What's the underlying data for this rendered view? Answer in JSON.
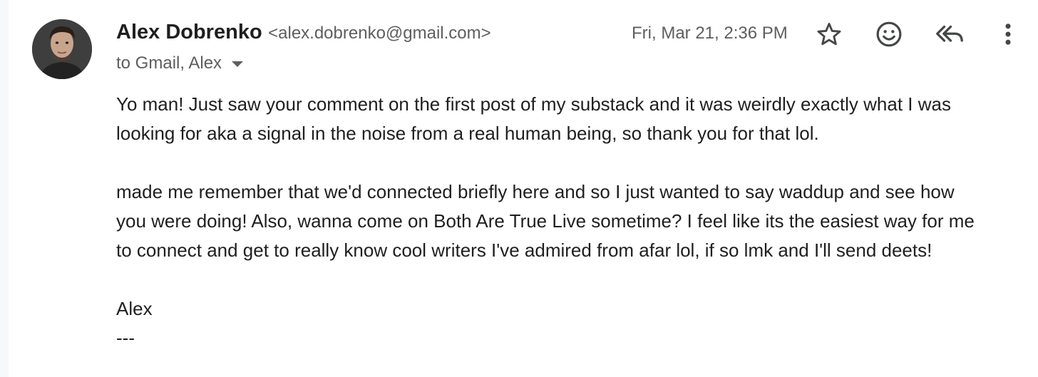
{
  "email": {
    "sender_name": "Alex Dobrenko",
    "sender_email": "<alex.dobrenko@gmail.com>",
    "recipients": "to Gmail, Alex",
    "date": "Fri, Mar 21, 2:36 PM",
    "body": {
      "p1_line1": "Yo man! Just saw your comment on the first post of my substack and it was weirdly exactly what I was",
      "p1_line2": "looking for aka a signal in the noise from a real human being, so thank you for that lol.",
      "p2_line1": "made me remember that we'd connected briefly here and so I just wanted to say waddup and see how",
      "p2_line2": "you were doing! Also, wanna come on Both Are True Live sometime? I feel like its the easiest way for me",
      "p2_line3": "to connect and get to really know cool writers I've admired from afar lol, if so lmk and I'll send deets!",
      "signature": "Alex",
      "signature_rule": "---"
    }
  },
  "icons": {
    "star": "star-icon",
    "emoji": "emoji-icon",
    "reply_all": "reply-all-icon",
    "more": "more-vert-icon"
  },
  "colors": {
    "text_primary": "#1f1f1f",
    "text_secondary": "#5e5e5e",
    "background": "#ffffff"
  }
}
